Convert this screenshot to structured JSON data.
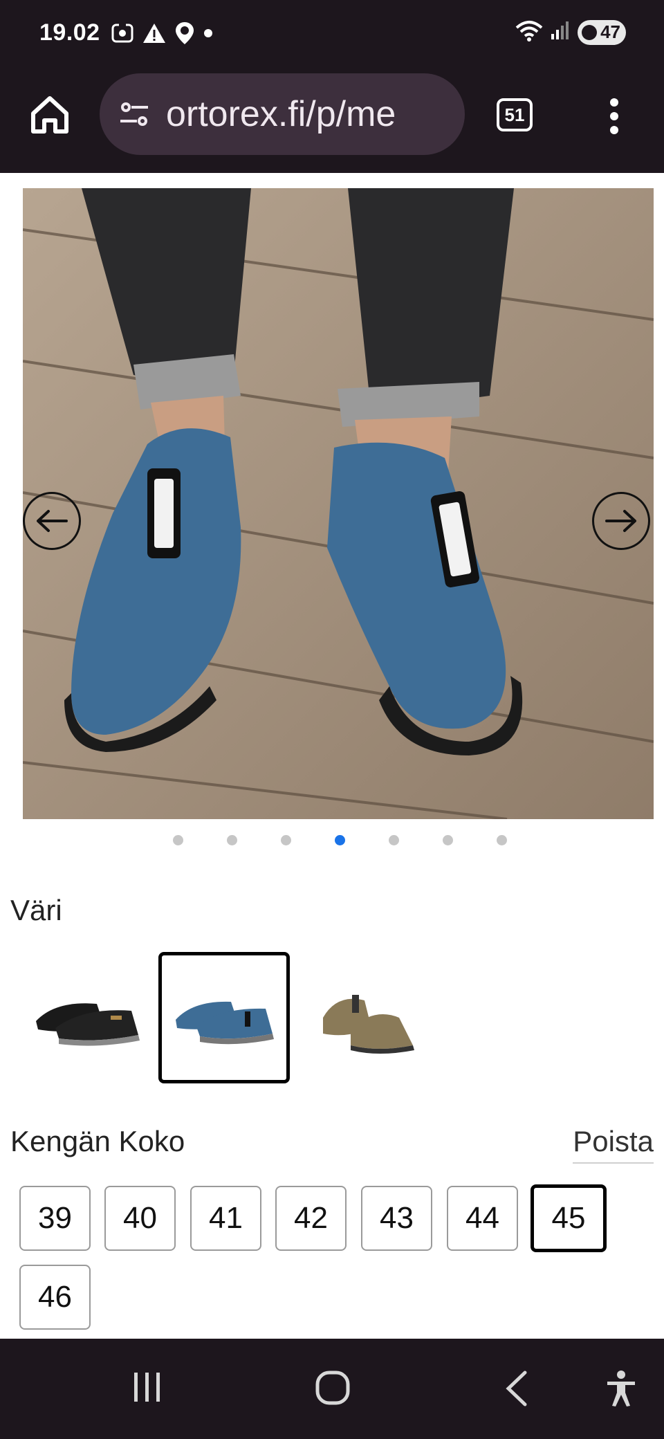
{
  "status_bar": {
    "time": "19.02",
    "icons": [
      "screenshot-icon",
      "warning-icon",
      "location-icon",
      "dot-icon"
    ],
    "right_icons": [
      "wifi-icon",
      "signal-icon"
    ],
    "battery": "47"
  },
  "browser": {
    "url": "ortorex.fi/p/me",
    "tab_count": "51"
  },
  "gallery": {
    "dot_count": 7,
    "active_dot": 4
  },
  "color_section": {
    "label": "Väri",
    "swatches": [
      {
        "name": "black",
        "hex": "#1a1a1a",
        "selected": false
      },
      {
        "name": "blue",
        "hex": "#3e6d96",
        "selected": true
      },
      {
        "name": "khaki",
        "hex": "#8a7a58",
        "selected": false
      }
    ]
  },
  "size_section": {
    "label": "Kengän Koko",
    "remove_label": "Poista",
    "sizes": [
      {
        "label": "39",
        "selected": false
      },
      {
        "label": "40",
        "selected": false
      },
      {
        "label": "41",
        "selected": false
      },
      {
        "label": "42",
        "selected": false
      },
      {
        "label": "43",
        "selected": false
      },
      {
        "label": "44",
        "selected": false
      },
      {
        "label": "45",
        "selected": true
      },
      {
        "label": "46",
        "selected": false
      }
    ]
  },
  "colors": {
    "chrome_bg": "#1d161d",
    "urlbar_bg": "#3d2f3d",
    "accent": "#1a73e8"
  }
}
